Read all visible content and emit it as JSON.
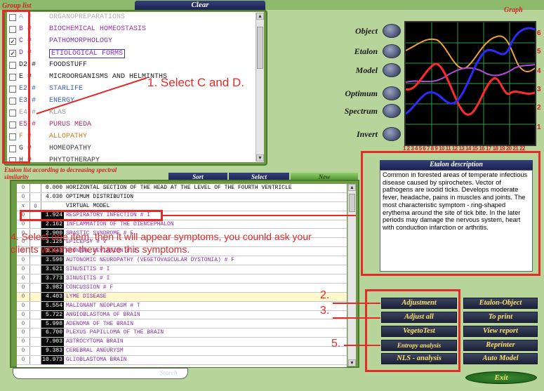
{
  "top": {
    "clear_label": "Clear",
    "graph_label": "Graph",
    "group_list_label": "Group list"
  },
  "group_list": [
    {
      "checked": false,
      "code": "A #",
      "name": "ORGANOPREPARATIONS",
      "color": "#b0b0b0"
    },
    {
      "checked": false,
      "code": "B #",
      "name": "BIOCHEMICAL  HOMEOSTASIS",
      "color": "#9a2fa8"
    },
    {
      "checked": true,
      "code": "C #",
      "name": "PATHOMORPHOLOGY",
      "color": "#7a2f9a"
    },
    {
      "checked": true,
      "code": "D #",
      "name": "ETIOLOGICAL  FORMS",
      "color": "#8a2fa8"
    },
    {
      "checked": false,
      "code": "D2 #",
      "name": "FOODSTUFF",
      "color": "#1a1a1a"
    },
    {
      "checked": false,
      "code": "E #",
      "name": "MICROORGANISMS  AND  HELMINTHS",
      "color": "#1a1a1a"
    },
    {
      "checked": false,
      "code": "E2 #",
      "name": "STARLIFE",
      "color": "#3a5fb0"
    },
    {
      "checked": false,
      "code": "E3 #",
      "name": "ENERGY",
      "color": "#3a5fb0"
    },
    {
      "checked": false,
      "code": "E4 #",
      "name": "KLAS",
      "color": "#9a9a9a"
    },
    {
      "checked": false,
      "code": "E5 #",
      "name": "PURUS MEDA",
      "color": "#a03070"
    },
    {
      "checked": false,
      "code": "F #",
      "name": "ALLOPATHY",
      "color": "#c8781e"
    },
    {
      "checked": false,
      "code": "G #",
      "name": "HOMEOPATHY",
      "color": "#3a3a3a"
    },
    {
      "checked": false,
      "code": "H #",
      "name": "PHYTOTHERAPY",
      "color": "#3a3a3a"
    }
  ],
  "graph_buttons": {
    "object": "Object",
    "etalon": "Etalon",
    "model": "Model",
    "optimum": "Optimum",
    "spectrum": "Spectrum",
    "invert": "Invert"
  },
  "graph": {
    "right_axis": [
      "6",
      "5",
      "4",
      "3",
      "2",
      "1"
    ],
    "bottom_axis": "1 2 3 4 5 6 7 8 9 10 11 12 13 14 15 16 17 18 19 20 21 22",
    "colors": {
      "blue": "#2b2bff",
      "red": "#ff2a2a",
      "purple": "#b24bd8",
      "orange": "#f0a040",
      "grid": "#2e9e3e"
    }
  },
  "etalon_list_label": "Etalon list according to decreasing spectral similarity",
  "list_tabs": {
    "sort": "Sort",
    "select": "Select",
    "new": "New"
  },
  "etalon_rows": [
    {
      "a": "0",
      "b": "",
      "val": "0.000",
      "name": "HORIZONTAL SECTION OF THE HEAD AT THE LEVEL OF THE FOURTH VENTRICLE",
      "color": "#000",
      "dark": false
    },
    {
      "a": "0",
      "b": "",
      "val": "4.030",
      "name": "OPTIMUM DISTRIBUTION",
      "color": "#000",
      "dark": false
    },
    {
      "a": "x",
      "b": "0",
      "val": "",
      "name": "VIRTUAL MODEL",
      "color": "#000",
      "dark": false
    },
    {
      "a": "0",
      "b": "",
      "val": "1.924",
      "name": "RESPIRATORY INFECTION # I",
      "color": "#8a2fa8",
      "dark": true
    },
    {
      "a": "0",
      "b": "",
      "val": "2.162",
      "name": "INFLAMMATION OF THE DIENCEPHALON",
      "color": "#8a2fa8",
      "dark": true
    },
    {
      "a": "0",
      "b": "",
      "val": "2.900",
      "name": "SPASTIC SYNDROME # E",
      "color": "#8a2fa8",
      "dark": true
    },
    {
      "a": "0",
      "b": "",
      "val": "3.125",
      "name": "EPILEPSY # V",
      "color": "#8a2fa8",
      "dark": true
    },
    {
      "a": "0",
      "b": "",
      "val": "3.443",
      "name": "FRONTAL DEVIATION # I",
      "color": "#8a2fa8",
      "dark": true
    },
    {
      "a": "0",
      "b": "",
      "val": "3.590",
      "name": "AUTONOMIC NEUROPATHY (VEGETOVASCULAR DYSTONIA) # F",
      "color": "#8a2fa8",
      "dark": true
    },
    {
      "a": "0",
      "b": "",
      "val": "3.621",
      "name": "SINUSITIS # I",
      "color": "#8a2fa8",
      "dark": true
    },
    {
      "a": "0",
      "b": "",
      "val": "3.773",
      "name": "SINUSITIS # I",
      "color": "#8a2fa8",
      "dark": true
    },
    {
      "a": "0",
      "b": "",
      "val": "3.982",
      "name": "CONCUSSION # F",
      "color": "#8a2fa8",
      "dark": true
    },
    {
      "a": "0",
      "b": "",
      "val": "4.403",
      "name": "LYME DISEASE",
      "color": "#8a2fa8",
      "dark": true
    },
    {
      "a": "0",
      "b": "",
      "val": "5.554",
      "name": "MALIGNANT NEOPLASM # T",
      "color": "#8a2fa8",
      "dark": true
    },
    {
      "a": "0",
      "b": "",
      "val": "5.722",
      "name": "ANGIOBLASTOMA OF BRAIN",
      "color": "#8a2fa8",
      "dark": true
    },
    {
      "a": "0",
      "b": "",
      "val": "5.998",
      "name": "ADENOMA OF THE BRAIN",
      "color": "#8a2fa8",
      "dark": true
    },
    {
      "a": "0",
      "b": "",
      "val": "6.700",
      "name": "PLEXUS PAPILLOMA OF THE BRAIN",
      "color": "#8a2fa8",
      "dark": true
    },
    {
      "a": "0",
      "b": "",
      "val": "7.903",
      "name": "ASTROCYTOMA BRAIN",
      "color": "#8a2fa8",
      "dark": true
    },
    {
      "a": "0",
      "b": "",
      "val": "9.383",
      "name": "CEREBRAL ANEURYSM",
      "color": "#8a2fa8",
      "dark": true
    },
    {
      "a": "0",
      "b": "",
      "val": "10.973",
      "name": "GLIOBLASTOMA BRAIN",
      "color": "#8a2fa8",
      "dark": true
    }
  ],
  "search_label": "Search",
  "etalon_description": {
    "title": "Etalon description",
    "text": "Common in forested areas of temperate infectious disease caused by spirochetes. Vector of pathogens are ixodid ticks. Develops moderate fever, headache, pains in muscles and joints. The most characteristic symptom - ring-shaped erythema around the site of tick bite. In the later periods may damage the nervous system, heart with conduction infarction or arthritis."
  },
  "action_buttons": {
    "adjustment": "Adjustment",
    "adjust_all": "Adjust all",
    "vegetotest": "VegetoTest",
    "entropy": "Entropy analysis",
    "nls": "NLS - analysis",
    "etalon_object": "Etalon-Object",
    "to_print": "To print",
    "view_report": "View report",
    "reprinter": "Reprinter",
    "auto_model": "Auto Model",
    "exit": "Exit"
  },
  "annotations": {
    "step1": "1. Select C and D.",
    "step4": "4. Select one item, then it will appear symptoms, you counld ask your clients whether they have this symptoms.",
    "step2": "2.",
    "step3": "3.",
    "step5": "5."
  }
}
